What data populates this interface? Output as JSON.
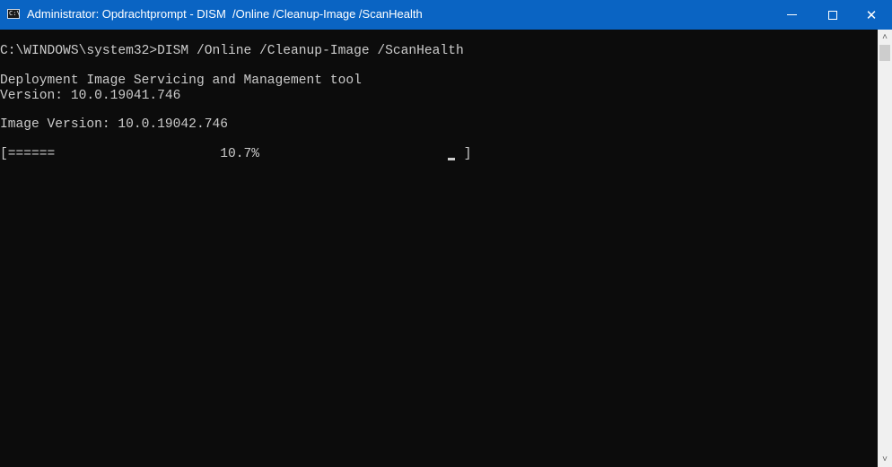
{
  "window": {
    "title": "Administrator: Opdrachtprompt - DISM  /Online /Cleanup-Image /ScanHealth",
    "icon_label": "C:\\",
    "controls": {
      "minimize": "minimize-icon",
      "maximize": "maximize-icon",
      "close": "✕"
    }
  },
  "console": {
    "lines": [
      "C:\\WINDOWS\\system32>DISM /Online /Cleanup-Image /ScanHealth",
      "",
      "Deployment Image Servicing and Management tool",
      "Version: 10.0.19041.746",
      "",
      "Image Version: 10.0.19042.746",
      "",
      "[======                     10.7%                          ] "
    ],
    "progress_percent": 10.7
  },
  "scrollbar": {
    "up": "˄",
    "down": "˅"
  },
  "colors": {
    "titlebar": "#0a64c3",
    "console_bg": "#0c0c0c",
    "console_fg": "#cccccc"
  }
}
